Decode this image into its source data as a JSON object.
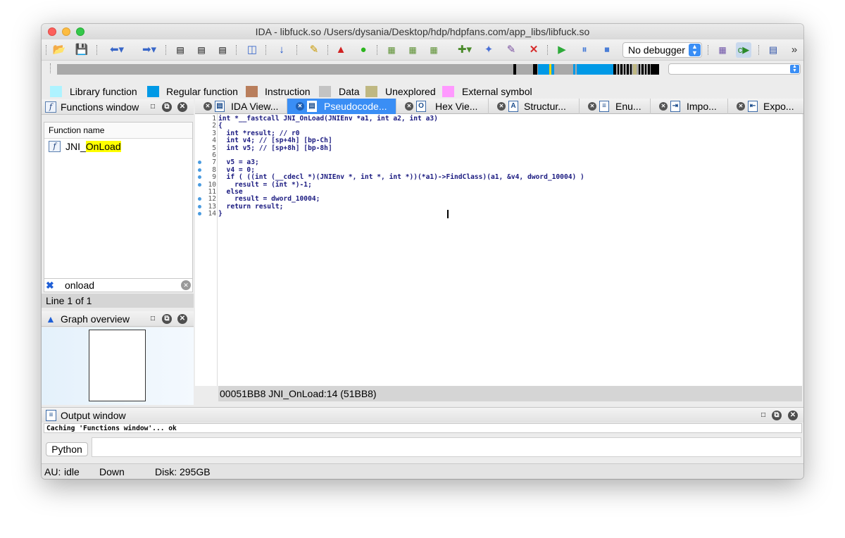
{
  "window": {
    "title": "IDA - libfuck.so /Users/dysania/Desktop/hdp/hdpfans.com/app_libs/libfuck.so"
  },
  "toolbar": {
    "debugger_select": "No debugger"
  },
  "legend": [
    {
      "label": "Library function",
      "color": "#aef3ff"
    },
    {
      "label": "Regular function",
      "color": "#0099e6"
    },
    {
      "label": "Instruction",
      "color": "#b97e5c"
    },
    {
      "label": "Data",
      "color": "#c3c3c3"
    },
    {
      "label": "Unexplored",
      "color": "#bfb882"
    },
    {
      "label": "External symbol",
      "color": "#ff99ff"
    }
  ],
  "functions_window": {
    "title": "Functions window",
    "column_header": "Function name",
    "items": [
      {
        "prefix": "JNI_",
        "match": "OnLoad"
      }
    ],
    "filter_value": "onload",
    "line_status": "Line 1 of 1"
  },
  "graph_overview": {
    "title": "Graph overview"
  },
  "tabs": [
    {
      "label": "IDA View...",
      "icon": "ida-view-icon"
    },
    {
      "label": "Pseudocode...",
      "icon": "pseudocode-icon"
    },
    {
      "label": "Hex Vie...",
      "icon": "hex-view-icon"
    },
    {
      "label": "Structur...",
      "icon": "structures-icon"
    },
    {
      "label": "Enu...",
      "icon": "enums-icon"
    },
    {
      "label": "Impo...",
      "icon": "imports-icon"
    },
    {
      "label": "Expo...",
      "icon": "exports-icon"
    }
  ],
  "pseudocode": {
    "lines": [
      {
        "num": "1",
        "dot": false,
        "text": "int *__fastcall JNI_OnLoad(JNIEnv *a1, int a2, int a3)"
      },
      {
        "num": "2",
        "dot": false,
        "text": "{"
      },
      {
        "num": "3",
        "dot": false,
        "text": "  int *result; // r0"
      },
      {
        "num": "4",
        "dot": false,
        "text": "  int v4; // [sp+4h] [bp-Ch]"
      },
      {
        "num": "5",
        "dot": false,
        "text": "  int v5; // [sp+8h] [bp-8h]"
      },
      {
        "num": "6",
        "dot": false,
        "text": ""
      },
      {
        "num": "7",
        "dot": true,
        "text": "  v5 = a3;"
      },
      {
        "num": "8",
        "dot": true,
        "text": "  v4 = 0;"
      },
      {
        "num": "9",
        "dot": true,
        "text": "  if ( ((int (__cdecl *)(JNIEnv *, int *, int *))(*a1)->FindClass)(a1, &v4, dword_10004) )"
      },
      {
        "num": "10",
        "dot": true,
        "text": "    result = (int *)-1;"
      },
      {
        "num": "11",
        "dot": false,
        "text": "  else"
      },
      {
        "num": "12",
        "dot": true,
        "text": "    result = dword_10004;"
      },
      {
        "num": "13",
        "dot": true,
        "text": "  return result;"
      },
      {
        "num": "14",
        "dot": true,
        "text": "}"
      }
    ],
    "address_status": "00051BB8  JNI_OnLoad:14 (51BB8)"
  },
  "output_window": {
    "title": "Output window",
    "log": "Caching 'Functions window'... ok",
    "python_button": "Python"
  },
  "statusbar": {
    "au": "AU:",
    "state": "idle",
    "direction": "Down",
    "disk": "Disk: 295GB"
  }
}
